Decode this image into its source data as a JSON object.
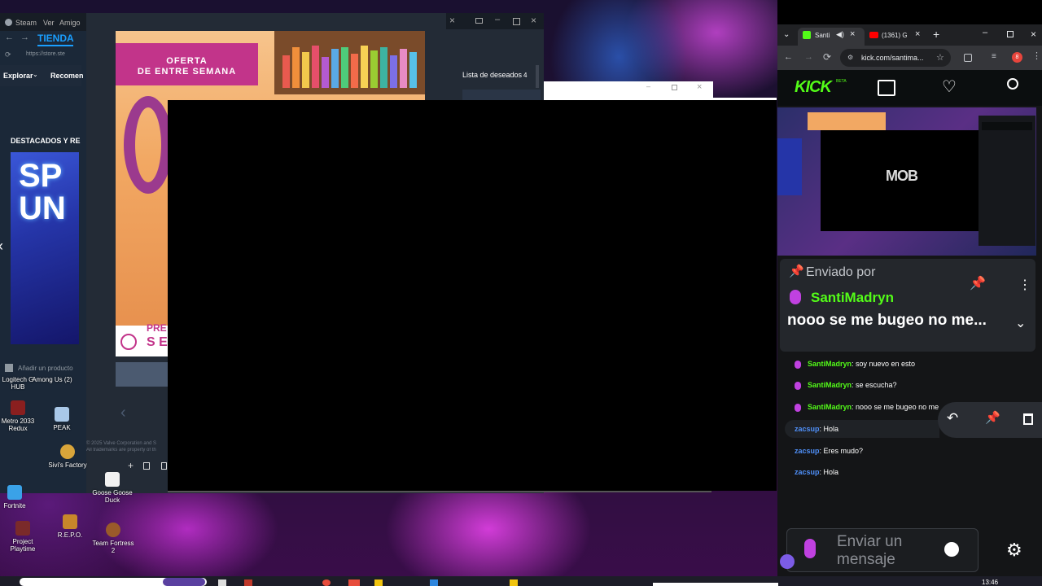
{
  "steam": {
    "menu": [
      "Steam",
      "Ver",
      "Amigo"
    ],
    "tienda_label": "TIENDA",
    "url_text": "https://store.ste",
    "nav_explorar": "Explorar",
    "nav_recomen": "Recomen",
    "section_title": "DESTACADOS Y RE",
    "feature_text_1": "SP",
    "feature_text_2": "UN",
    "offer_title_1": "OFERTA",
    "offer_title_2": "DE ENTRE SEMANA",
    "offer_footer": "PRE",
    "offer_footer_2": "S E",
    "wishlist_label": "Lista de deseados",
    "wishlist_count": "4",
    "add_product": "Añadir un producto",
    "copyright_1": "© 2025 Valve Corporation and S",
    "copyright_2": "All trademarks are property of th"
  },
  "desktop_icons": [
    {
      "label": "Logitech G HUB"
    },
    {
      "label": "Among Us (2)"
    },
    {
      "label": "Metro 2033 Redux"
    },
    {
      "label": "PEAK"
    },
    {
      "label": "Sivi's Factory"
    },
    {
      "label": "Goose Goose Duck"
    },
    {
      "label": "Fortnite"
    },
    {
      "label": "Project Playtime"
    },
    {
      "label": "R.E.P.O."
    },
    {
      "label": "Team Fortress 2"
    }
  ],
  "taskbar": {
    "clock": "13:46"
  },
  "chrome": {
    "tab1_label": "Santi",
    "tab2_label": "(1361) G",
    "address": "kick.com/santima...",
    "extension_badge": "8"
  },
  "kick": {
    "logo": "KICK",
    "logo_badge": "BETA",
    "stream_logo": "MOB",
    "pinned": {
      "label": "Enviado por",
      "user": "SantiMadryn",
      "message": "nooo se me bugeo no me..."
    },
    "chat": [
      {
        "user": "SantiMadryn",
        "text": ": soy nuevo en esto",
        "color": "green"
      },
      {
        "user": "SantiMadryn",
        "text": ": se escucha?",
        "color": "green"
      },
      {
        "user": "SantiMadryn",
        "text": ": nooo se me bugeo no me",
        "color": "green"
      },
      {
        "user": "zacsup",
        "text": ": Hola",
        "color": "blue"
      },
      {
        "user": "zacsup",
        "text": ": Eres mudo?",
        "color": "blue"
      },
      {
        "user": "zacsup",
        "text": ": Hola",
        "color": "blue"
      }
    ],
    "message_placeholder": "Enviar un mensaje"
  }
}
